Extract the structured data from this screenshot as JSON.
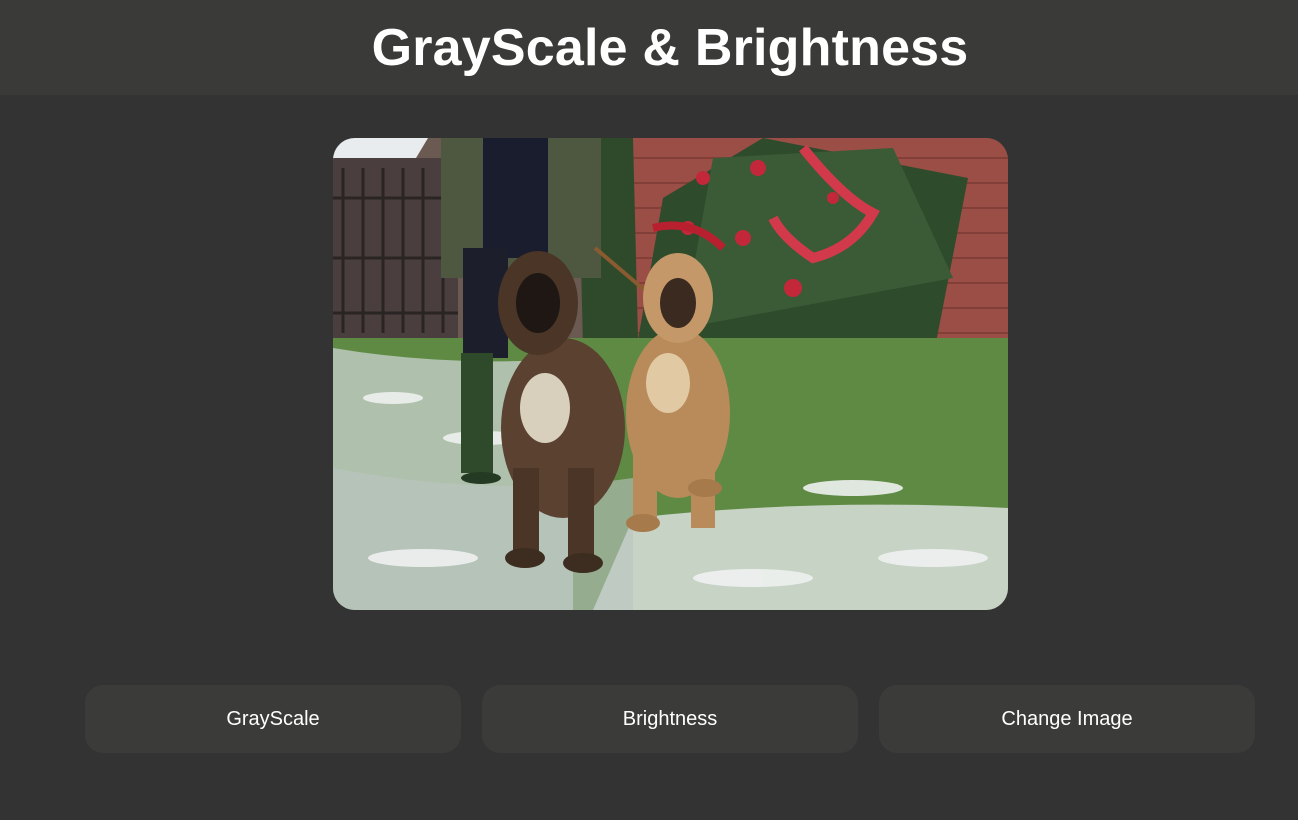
{
  "header": {
    "title": "GrayScale & Brightness"
  },
  "image": {
    "subject": "two-afghan-hound-puppies-by-christmas-tree"
  },
  "buttons": {
    "grayscale_label": "GrayScale",
    "brightness_label": "Brightness",
    "change_image_label": "Change Image"
  },
  "colors": {
    "page_background": "#333333",
    "header_background": "#3a3a38",
    "button_background": "#3b3b39",
    "text": "#ffffff"
  }
}
